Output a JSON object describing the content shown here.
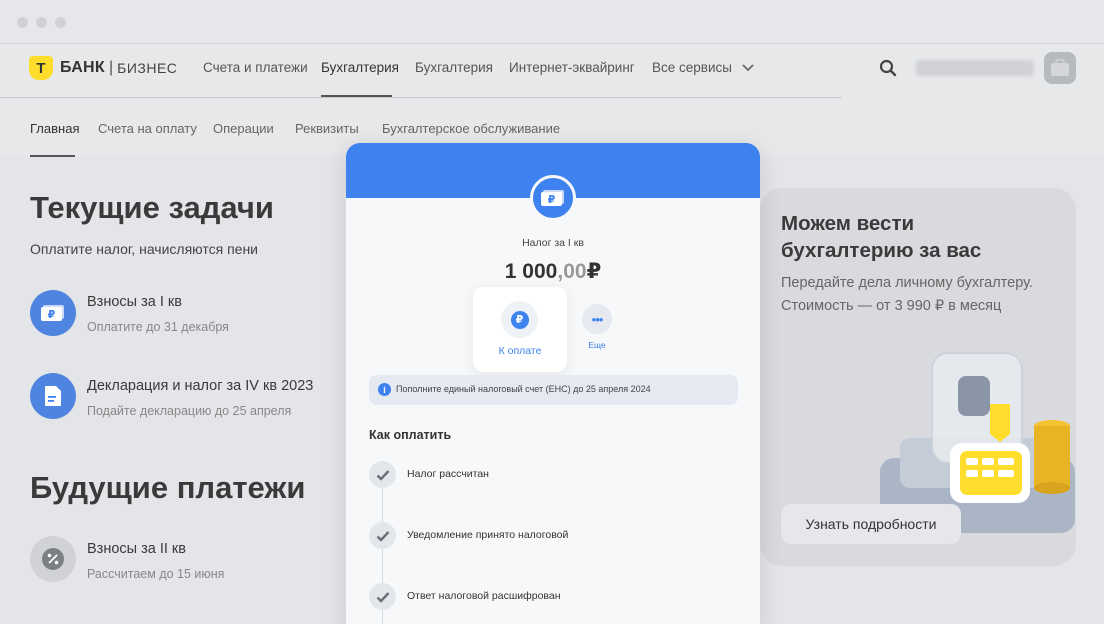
{
  "logo": {
    "mark": "T",
    "brand": "БАНК",
    "divider": "|",
    "business": "БИЗНЕС"
  },
  "topnav": [
    "Счета и платежи",
    "Бухгалтерия",
    "Бухгалтерия",
    "Интернет-эквайринг",
    "Все сервисы"
  ],
  "subnav": [
    "Главная",
    "Счета на оплату",
    "Операции",
    "Реквизиты",
    "Бухгалтерское обслуживание"
  ],
  "current_tasks": {
    "title": "Текущие задачи",
    "subtitle": "Оплатите налог, начисляются пени",
    "items": [
      {
        "title": "Взносы за I кв",
        "sub": "Оплатите до 31 декабря",
        "icon": "ruble-banknote-icon"
      },
      {
        "title": "Декларация и налог за IV кв 2023",
        "sub": "Подайте декларацию до 25 апреля",
        "icon": "document-icon"
      }
    ]
  },
  "future_payments": {
    "title": "Будущие платежи",
    "items": [
      {
        "title": "Взносы за II кв",
        "sub": "Рассчитаем до 15 июня",
        "icon": "percent-icon"
      }
    ]
  },
  "promo": {
    "title": "Можем вести бухгалтерию за вас",
    "text": "Передайте дела личному бухгалтеру. Стоимость — от 3 990 ₽ в месяц",
    "button": "Узнать подробности"
  },
  "modal": {
    "label": "Налог за I кв",
    "amount_int": "1 000",
    "amount_dec": ",00",
    "currency": "₽",
    "pay_label": "К оплате",
    "more_label": "Еще",
    "notice": "Пополните единый налоговый счет (ЕНС) до 25 апреля 2024",
    "how_title": "Как оплатить",
    "steps": [
      "Налог рассчитан",
      "Уведомление принято налоговой",
      "Ответ налоговой расшифрован"
    ]
  },
  "colors": {
    "accent": "#3d82ee",
    "brand_yellow": "#ffdd2d"
  }
}
